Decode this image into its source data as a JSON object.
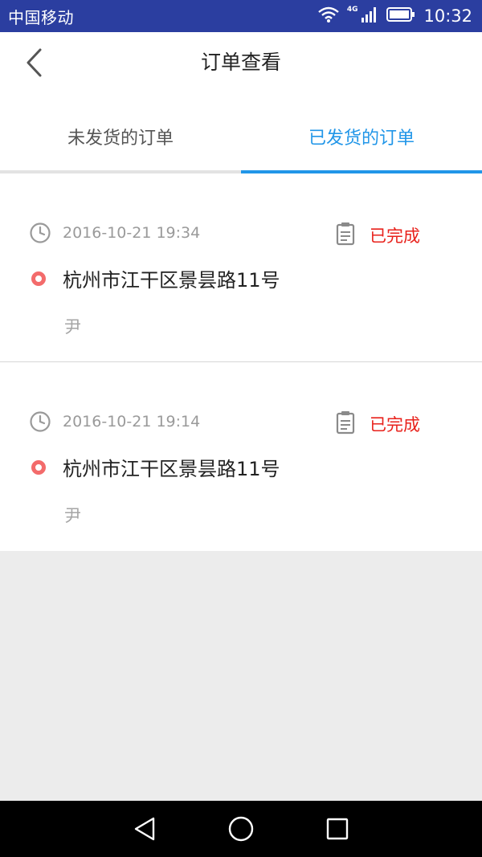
{
  "status_bar": {
    "carrier": "中国移动",
    "network": "4G",
    "time": "10:32"
  },
  "header": {
    "title": "订单查看",
    "back_icon": "chevron-left-icon"
  },
  "tabs": [
    {
      "label": "未发货的订单",
      "active": false
    },
    {
      "label": "已发货的订单",
      "active": true
    }
  ],
  "orders": [
    {
      "time": "2016-10-21 19:34",
      "status": "已完成",
      "address": "杭州市江干区景昙路11号",
      "recipient": "尹"
    },
    {
      "time": "2016-10-21 19:14",
      "status": "已完成",
      "address": "杭州市江干区景昙路11号",
      "recipient": "尹"
    }
  ],
  "colors": {
    "status_bar": "#2b3ea0",
    "accent": "#2196e8",
    "status_done": "#e8211b",
    "location_dot": "#f36b6b"
  }
}
